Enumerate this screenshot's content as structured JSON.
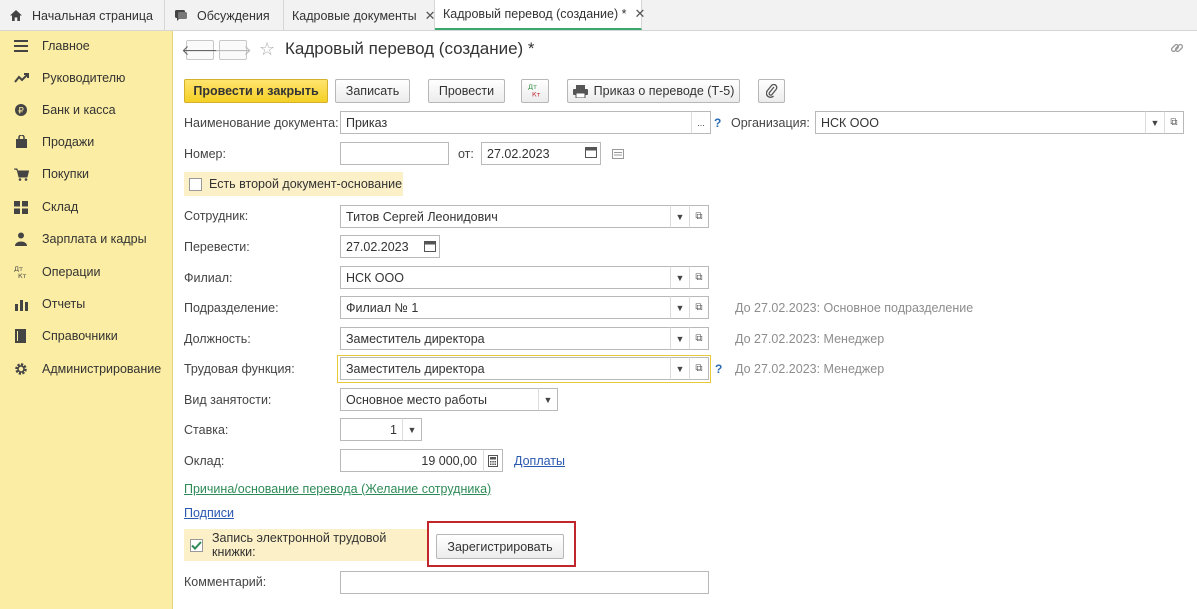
{
  "tabs": [
    {
      "label": "Начальная страница",
      "icon": "home-icon"
    },
    {
      "label": "Обсуждения",
      "icon": "chat-icon"
    },
    {
      "label": "Кадровые документы",
      "close": "✕"
    },
    {
      "label": "Кадровый перевод (создание) *",
      "close": "✕"
    }
  ],
  "sidebar": {
    "items": [
      {
        "label": "Главное",
        "icon": "menu-lines-icon"
      },
      {
        "label": "Руководителю",
        "icon": "trend-chart-icon"
      },
      {
        "label": "Банк и касса",
        "icon": "coin-icon"
      },
      {
        "label": "Продажи",
        "icon": "shopping-bag-icon"
      },
      {
        "label": "Покупки",
        "icon": "cart-icon"
      },
      {
        "label": "Склад",
        "icon": "warehouse-grid-icon"
      },
      {
        "label": "Зарплата и кадры",
        "icon": "person-icon"
      },
      {
        "label": "Операции",
        "icon": "dt-kt-icon"
      },
      {
        "label": "Отчеты",
        "icon": "bar-chart-icon"
      },
      {
        "label": "Справочники",
        "icon": "book-icon"
      },
      {
        "label": "Администрирование",
        "icon": "gear-icon"
      }
    ]
  },
  "header": {
    "title": "Кадровый перевод (создание) *",
    "star": "☆",
    "link_glyph": "🔗"
  },
  "toolbar": {
    "post_close": "Провести и закрыть",
    "save": "Записать",
    "post": "Провести",
    "dtkt": "Дт Кт",
    "print_order": "Приказ о переводе (Т-5)"
  },
  "form": {
    "doc_name_label": "Наименование документа:",
    "doc_name_value": "Приказ",
    "doc_name_more": "...",
    "help": "?",
    "org_label": "Организация:",
    "org_value": "НСК ООО",
    "number_label": "Номер:",
    "number_value": "",
    "from_label": "от:",
    "date_value": "27.02.2023",
    "second_basis_label": "Есть второй документ-основание",
    "employee_label": "Сотрудник:",
    "employee_value": "Титов Сергей Леонидович",
    "transfer_label": "Перевести:",
    "transfer_value": "27.02.2023",
    "branch_label": "Филиал:",
    "branch_value": "НСК ООО",
    "dept_label": "Подразделение:",
    "dept_value": "Филиал № 1",
    "dept_hint": "До 27.02.2023: Основное подразделение",
    "position_label": "Должность:",
    "position_value": "Заместитель директора",
    "position_hint": "До 27.02.2023: Менеджер",
    "function_label": "Трудовая функция:",
    "function_value": "Заместитель директора",
    "function_hint": "До 27.02.2023: Менеджер",
    "employment_label": "Вид занятости:",
    "employment_value": "Основное место работы",
    "rate_label": "Ставка:",
    "rate_value": "1",
    "salary_label": "Оклад:",
    "salary_value": "19 000,00",
    "extras_link": "Доплаты",
    "reason_link": "Причина/основание перевода (Желание сотрудника)",
    "signatures_link": "Подписи",
    "etk_label": "Запись электронной трудовой книжки:",
    "etk_checked": true,
    "register_button": "Зарегистрировать",
    "comment_label": "Комментарий:",
    "comment_value": ""
  },
  "colors": {
    "sidebar_bg": "#fbeda3",
    "primary_button": "#f5d024",
    "highlight_frame": "#c0262c",
    "active_tab_underline": "#3aa76d"
  }
}
